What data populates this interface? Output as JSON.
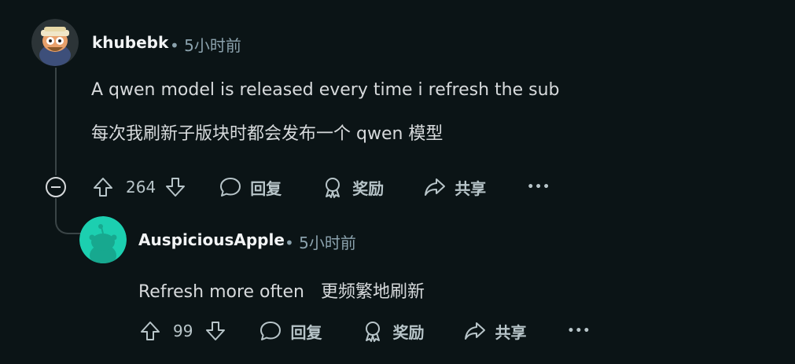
{
  "comments": [
    {
      "username": "khubebk",
      "meta": "• 5小时前",
      "text_en": "A qwen model is released every time i refresh the sub",
      "text_zh": "每次我刷新子版块时都会发布一个 qwen 模型",
      "votes": "264",
      "reply_label": "回复",
      "award_label": "奖励",
      "share_label": "共享",
      "more_label": "•••"
    },
    {
      "username": "AuspiciousApple",
      "meta": "• 5小时前",
      "text": "Refresh more often   更频繁地刷新",
      "votes": "99",
      "reply_label": "回复",
      "award_label": "奖励",
      "share_label": "共享",
      "more_label": "•••"
    }
  ],
  "colors": {
    "background": "#0b1416",
    "avatar2": "#1ccfb0",
    "line": "#3a4446"
  }
}
